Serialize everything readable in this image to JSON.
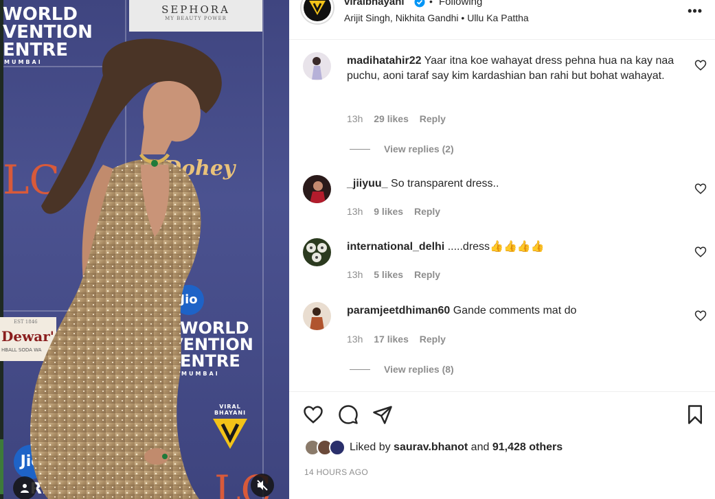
{
  "media": {
    "backdrop_texts": {
      "world_top": "WORLD",
      "vention_top": "VENTION",
      "entre_top": "ENTRE",
      "mumbai_top": "MUMBAI",
      "sephora": "SEPHORA",
      "sephora_tag": "MY BEAUTY POWER",
      "lcc_left": "LC",
      "dohey": "Dohey",
      "jio": "Jio",
      "world_mid": "WORLD",
      "vention_mid": "VENTION",
      "entre_mid": "ENTRE",
      "mumbai_mid": "MUMBAI",
      "dewars": "Dewar's",
      "dewars_est": "EST 1846",
      "dewars_sub": "HBALL SODA WA",
      "jio_bottom": "Jio",
      "rl": "RL",
      "lcc_bottom": "LC"
    },
    "watermark": "VIRAL BHAYANI",
    "icons": [
      "person-icon",
      "muted-icon"
    ]
  },
  "header": {
    "username": "viralbhayani",
    "separator": "•",
    "follow_status": "Following",
    "audio": "Arijit Singh, Nikhita Gandhi • Ullu Ka Pattha",
    "more": "•••"
  },
  "comments": [
    {
      "username": "madihatahir22",
      "text": "Yaar itna koe wahayat dress pehna hua na kay naa puchu, aoni taraf say kim kardashian ban rahi but bohat wahayat.",
      "time": "13h",
      "likes": "29 likes",
      "reply": "Reply",
      "view_replies": "View replies (2)"
    },
    {
      "username": "_jiiyuu_",
      "text": "So transparent dress..",
      "time": "13h",
      "likes": "9 likes",
      "reply": "Reply"
    },
    {
      "username": "international_delhi",
      "text": ".....dress👍👍👍👍",
      "time": "13h",
      "likes": "5 likes",
      "reply": "Reply"
    },
    {
      "username": "paramjeetdhiman60",
      "text": "Gande comments mat do",
      "time": "13h",
      "likes": "17 likes",
      "reply": "Reply",
      "view_replies": "View replies (8)"
    }
  ],
  "liked_by": {
    "prefix": "Liked by",
    "user": "saurav.bhanot",
    "and": "and",
    "others": "91,428 others"
  },
  "timestamp": "14 HOURS AGO",
  "colors": {
    "text": "#262626",
    "secondary": "#8e8e8e",
    "verified": "#0095f6",
    "divider": "#efefef"
  }
}
